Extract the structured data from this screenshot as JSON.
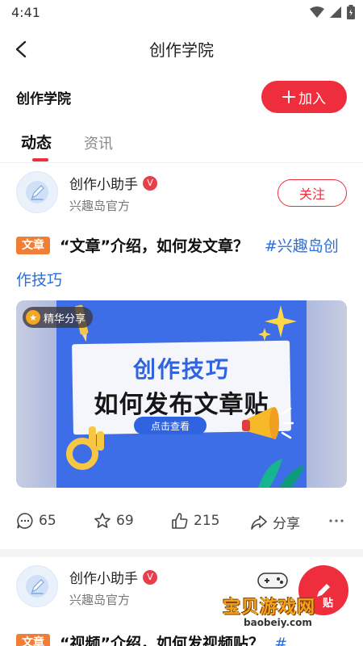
{
  "status_bar": {
    "time": "4:41"
  },
  "nav": {
    "title": "创作学院"
  },
  "group": {
    "name": "创作学院",
    "join_label": "加入"
  },
  "tabs": [
    {
      "label": "动态"
    },
    {
      "label": "资讯"
    }
  ],
  "posts": [
    {
      "author": "创作小助手",
      "verified_badge": "V",
      "source": "兴趣岛官方",
      "follow_label": "关注",
      "type_tag": "文章",
      "title": "“文章”介绍，如何发文章？",
      "hashtag": "#兴趣岛创作技巧",
      "cover": {
        "badge": "精华分享",
        "headline": "创作技巧",
        "subheadline": "如何发布文章贴",
        "cta": "点击查看"
      },
      "comments": "65",
      "favorites": "69",
      "likes": "215",
      "share_label": "分享"
    },
    {
      "author": "创作小助手",
      "verified_badge": "V",
      "source": "兴趣岛官方",
      "type_tag": "文章",
      "title": "“视频”介绍，如何发视频贴？",
      "hashtag": "#"
    }
  ],
  "watermark": {
    "text": "宝贝游戏网",
    "url_text": "baobeiy.com",
    "fab_label": "贴"
  },
  "colors": {
    "accent": "#ee2d3d",
    "link": "#2b6fd6",
    "tag_orange": "#f07e34"
  },
  "icons": [
    "back-arrow-icon",
    "wifi-icon",
    "signal-icon",
    "battery-icon",
    "plus-icon",
    "verified-icon",
    "comment-icon",
    "star-icon",
    "thumbs-up-icon",
    "share-icon",
    "more-icon",
    "pen-icon"
  ]
}
